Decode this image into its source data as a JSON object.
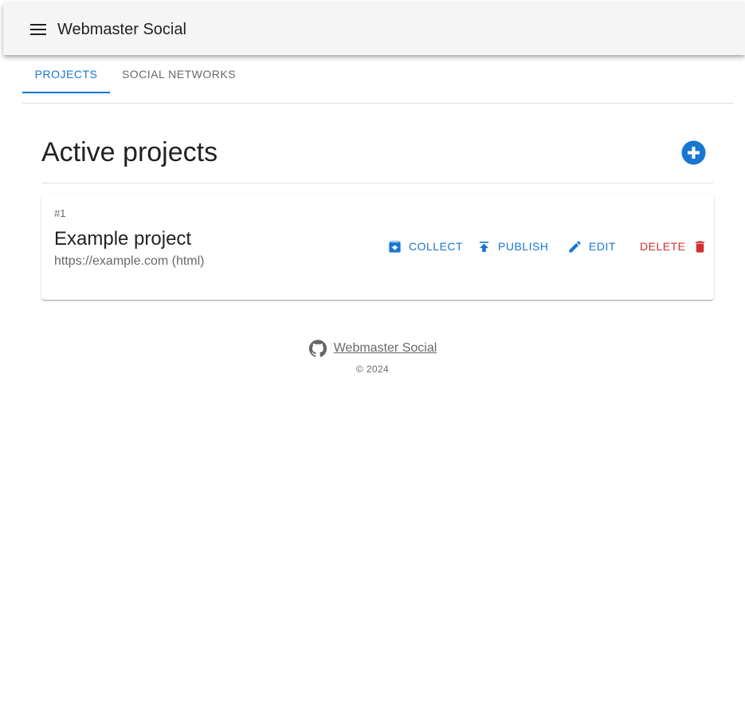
{
  "app": {
    "title": "Webmaster Social",
    "menu_icon": "hamburger-menu-icon"
  },
  "tabs": [
    {
      "label": "PROJECTS",
      "active": true
    },
    {
      "label": "SOCIAL NETWORKS",
      "active": false
    }
  ],
  "main": {
    "heading": "Active projects",
    "add_icon": "plus-circle-icon",
    "projects": [
      {
        "number": "#1",
        "name": "Example project",
        "subtitle": "https://example.com (html)",
        "actions": {
          "collect": {
            "label": "COLLECT",
            "icon": "archive-icon"
          },
          "publish": {
            "label": "PUBLISH",
            "icon": "upload-icon"
          },
          "edit": {
            "label": "EDIT",
            "icon": "pencil-icon"
          },
          "delete": {
            "label": "DELETE",
            "icon": "trash-icon"
          }
        }
      }
    ]
  },
  "footer": {
    "link_text": "Webmaster Social",
    "icon": "github-icon",
    "copyright": "© 2024"
  },
  "colors": {
    "primary": "#1976d2",
    "danger": "#d32f2f",
    "appbar": "#f5f5f5"
  }
}
